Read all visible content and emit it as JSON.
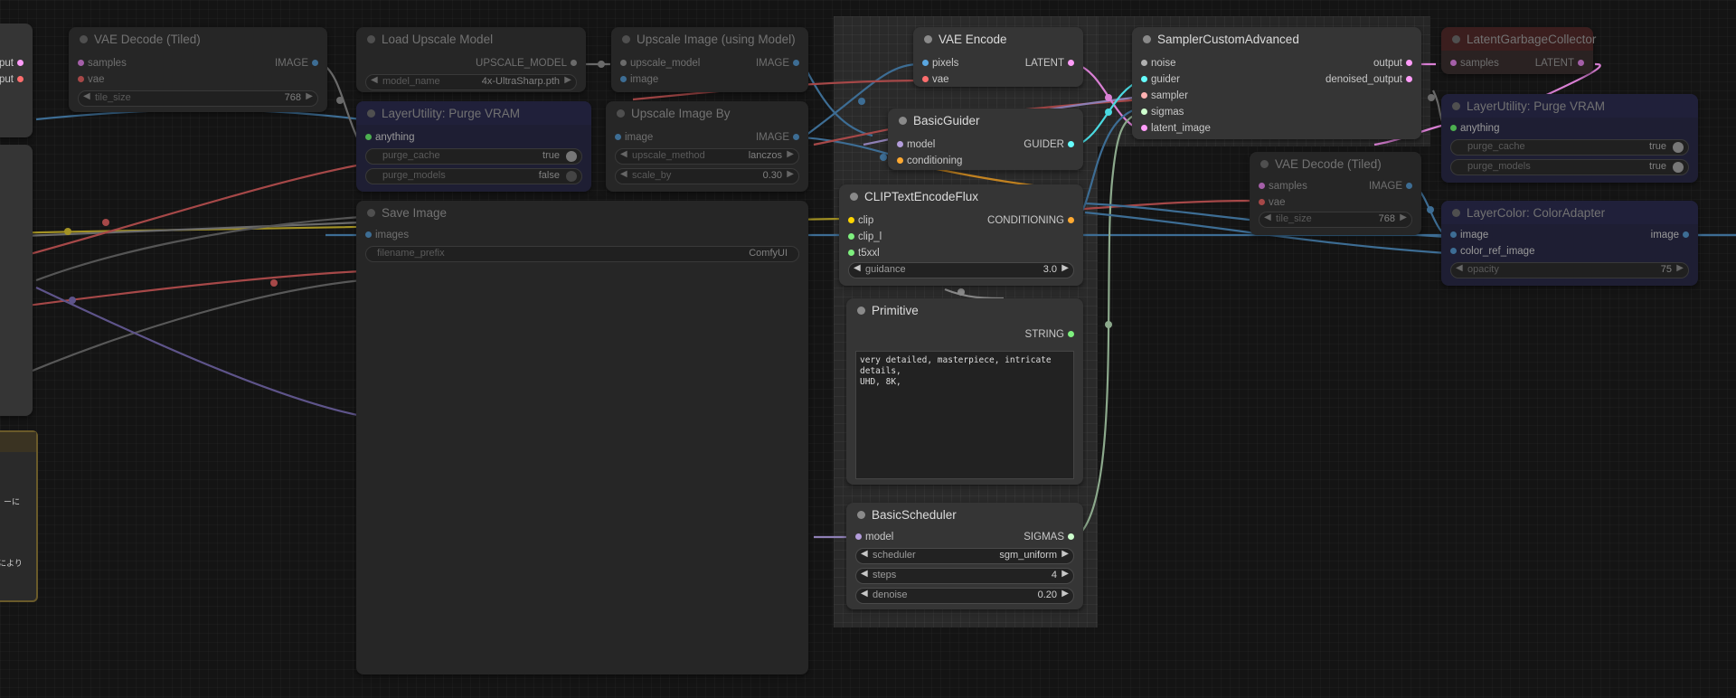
{
  "colors": {
    "background": "#141414",
    "node": "#353535",
    "image": "#5aa6e0",
    "latent": "#ff9cf9",
    "vae": "#ff6e6e",
    "model": "#b39ddb",
    "conditioning": "#ffa931",
    "clip": "#ffd500",
    "string": "#7ef07e",
    "guider": "#66ffff",
    "sigmas": "#cdffcd",
    "noise": "#b0b0b0"
  },
  "left_edge": {
    "out1": "tput",
    "out2": "tput",
    "jp1": "ーに",
    "jp2": "により"
  },
  "vae_decode_tiled_1": {
    "title": "VAE Decode (Tiled)",
    "inputs": [
      "samples",
      "vae"
    ],
    "output": "IMAGE",
    "tile_size_label": "tile_size",
    "tile_size_value": "768"
  },
  "load_upscale_model": {
    "title": "Load Upscale Model",
    "output": "UPSCALE_MODEL",
    "model_name_label": "model_name",
    "model_name_value": "4x-UltraSharp.pth"
  },
  "upscale_image_using_model": {
    "title": "Upscale Image (using Model)",
    "inputs": [
      "upscale_model",
      "image"
    ],
    "output": "IMAGE"
  },
  "purge_vram_1": {
    "title": "LayerUtility: Purge VRAM",
    "input": "anything",
    "purge_cache_label": "purge_cache",
    "purge_cache_value": "true",
    "purge_models_label": "purge_models",
    "purge_models_value": "false"
  },
  "upscale_image_by": {
    "title": "Upscale Image By",
    "input": "image",
    "output": "IMAGE",
    "upscale_method_label": "upscale_method",
    "upscale_method_value": "lanczos",
    "scale_by_label": "scale_by",
    "scale_by_value": "0.30"
  },
  "save_image": {
    "title": "Save Image",
    "input": "images",
    "filename_prefix_label": "filename_prefix",
    "filename_prefix_value": "ComfyUI"
  },
  "vae_encode": {
    "title": "VAE Encode",
    "inputs": [
      "pixels",
      "vae"
    ],
    "output": "LATENT"
  },
  "basic_guider": {
    "title": "BasicGuider",
    "inputs": [
      "model",
      "conditioning"
    ],
    "output": "GUIDER"
  },
  "clip_text_encode_flux": {
    "title": "CLIPTextEncodeFlux",
    "inputs": [
      "clip",
      "clip_l",
      "t5xxl"
    ],
    "output": "CONDITIONING",
    "guidance_label": "guidance",
    "guidance_value": "3.0"
  },
  "primitive": {
    "title": "Primitive",
    "output": "STRING",
    "text": "very detailed, masterpiece, intricate details,\nUHD, 8K,"
  },
  "basic_scheduler": {
    "title": "BasicScheduler",
    "input": "model",
    "output": "SIGMAS",
    "scheduler_label": "scheduler",
    "scheduler_value": "sgm_uniform",
    "steps_label": "steps",
    "steps_value": "4",
    "denoise_label": "denoise",
    "denoise_value": "0.20"
  },
  "sampler_custom_advanced": {
    "title": "SamplerCustomAdvanced",
    "inputs": [
      "noise",
      "guider",
      "sampler",
      "sigmas",
      "latent_image"
    ],
    "outputs": [
      "output",
      "denoised_output"
    ]
  },
  "latent_garbage_collector": {
    "title": "LatentGarbageCollector",
    "input": "samples",
    "output": "LATENT"
  },
  "purge_vram_2": {
    "title": "LayerUtility: Purge VRAM",
    "input": "anything",
    "purge_cache_label": "purge_cache",
    "purge_cache_value": "true",
    "purge_models_label": "purge_models",
    "purge_models_value": "true"
  },
  "vae_decode_tiled_2": {
    "title": "VAE Decode (Tiled)",
    "inputs": [
      "samples",
      "vae"
    ],
    "output": "IMAGE",
    "tile_size_label": "tile_size",
    "tile_size_value": "768"
  },
  "color_adapter": {
    "title": "LayerColor: ColorAdapter",
    "inputs": [
      "image",
      "color_ref_image"
    ],
    "output": "image",
    "opacity_label": "opacity",
    "opacity_value": "75"
  }
}
